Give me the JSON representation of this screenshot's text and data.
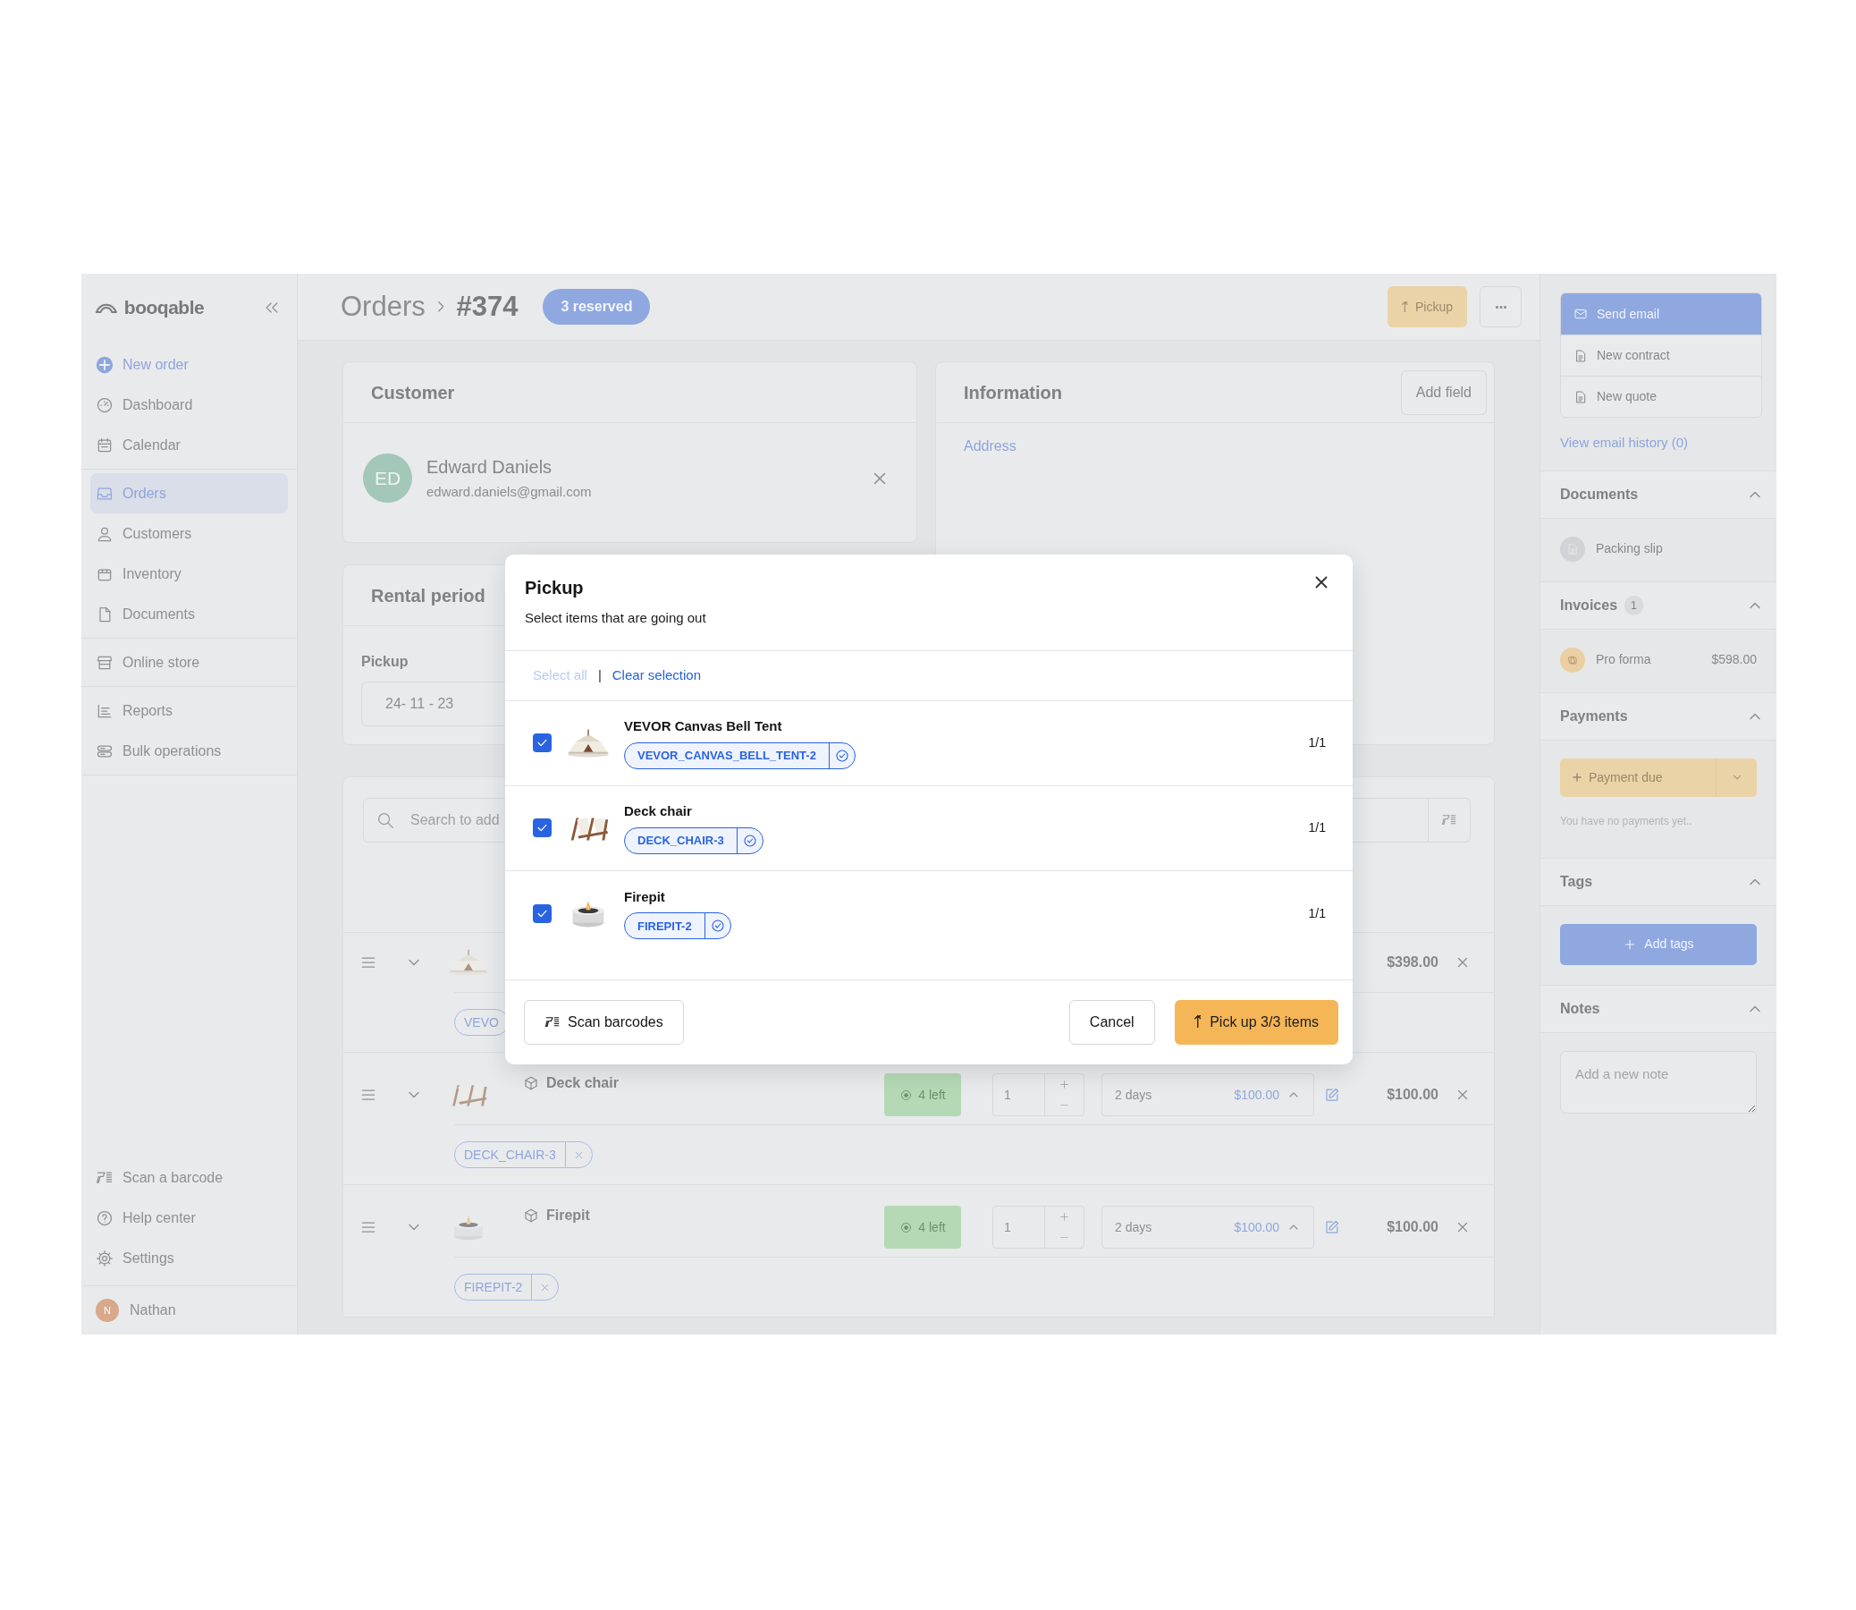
{
  "sidebar": {
    "brand": "booqable",
    "groups": [
      {
        "items": [
          {
            "label": "New order",
            "kind": "action",
            "selected": false
          },
          {
            "label": "Dashboard",
            "kind": "link",
            "selected": false
          },
          {
            "label": "Calendar",
            "kind": "link",
            "selected": false
          }
        ]
      },
      {
        "items": [
          {
            "label": "Orders",
            "kind": "link",
            "selected": true
          },
          {
            "label": "Customers",
            "kind": "link",
            "selected": false
          },
          {
            "label": "Inventory",
            "kind": "link",
            "selected": false
          },
          {
            "label": "Documents",
            "kind": "link",
            "selected": false
          }
        ]
      },
      {
        "items": [
          {
            "label": "Online store",
            "kind": "link",
            "selected": false
          }
        ]
      },
      {
        "items": [
          {
            "label": "Reports",
            "kind": "link",
            "selected": false
          },
          {
            "label": "Bulk operations",
            "kind": "link",
            "selected": false
          }
        ]
      }
    ],
    "bottom_items": [
      {
        "label": "Scan a barcode",
        "selected": false
      },
      {
        "label": "Help center",
        "selected": false
      },
      {
        "label": "Settings",
        "selected": false
      }
    ],
    "user": {
      "initial": "N",
      "name": "Nathan"
    }
  },
  "header": {
    "breadcrumb": "Orders",
    "order_number": "#374",
    "status": "3 reserved",
    "pickup_button": "Pickup"
  },
  "customer": {
    "title": "Customer",
    "initials": "ED",
    "name": "Edward Daniels",
    "email": "edward.daniels@gmail.com"
  },
  "information": {
    "title": "Information",
    "add_button": "Add field",
    "address_link": "Address"
  },
  "rental_period": {
    "title": "Rental period",
    "pickup_label": "Pickup",
    "pickup_date": "24- 11 - 23"
  },
  "order_lines": {
    "search_placeholder": "Search to add",
    "lines": [
      {
        "total": "$398.00",
        "tag": "VEVO",
        "tag_remove": false
      },
      {
        "name": "Deck chair",
        "stock": "4 left",
        "quantity": "1",
        "duration": "2 days",
        "rate": "$100.00",
        "total": "$100.00",
        "tag": "DECK_CHAIR-3",
        "tag_remove": true
      },
      {
        "name": "Firepit",
        "stock": "4 left",
        "quantity": "1",
        "duration": "2 days",
        "rate": "$100.00",
        "total": "$100.00",
        "tag": "FIREPIT-2",
        "tag_remove": true
      }
    ]
  },
  "right_panel": {
    "email_actions": [
      {
        "label": "Send email",
        "selected": true
      },
      {
        "label": "New contract",
        "selected": false
      },
      {
        "label": "New quote",
        "selected": false
      }
    ],
    "history_link": "View email history (0)",
    "sections": [
      {
        "kind": "documents",
        "title": "Documents",
        "expanded": true,
        "items": [
          {
            "label": "Packing slip"
          }
        ]
      },
      {
        "kind": "invoices",
        "title": "Invoices",
        "count": "1",
        "expanded": true,
        "items": [
          {
            "label": "Pro forma",
            "amount": "$598.00"
          }
        ]
      },
      {
        "kind": "payments",
        "title": "Payments",
        "expanded": true,
        "button": "Payment due",
        "empty_text": "You have no payments yet.."
      },
      {
        "kind": "tags",
        "title": "Tags",
        "expanded": true,
        "button": "Add tags"
      },
      {
        "kind": "notes",
        "title": "Notes",
        "expanded": true,
        "placeholder": "Add a new note"
      }
    ]
  },
  "modal": {
    "title": "Pickup",
    "subtitle": "Select items that are going out",
    "select_all": {
      "label": "Select all",
      "disabled": true
    },
    "separator": "|",
    "clear_selection": "Clear selection",
    "items": [
      {
        "name": "VEVOR Canvas Bell Tent",
        "tag": "VEVOR_CANVAS_BELL_TENT-2",
        "checked": true,
        "count": "1/1"
      },
      {
        "name": "Deck chair",
        "tag": "DECK_CHAIR-3",
        "checked": true,
        "count": "1/1"
      },
      {
        "name": "Firepit",
        "tag": "FIREPIT-2",
        "checked": true,
        "count": "1/1"
      }
    ],
    "scan_button": "Scan barcodes",
    "cancel_button": "Cancel",
    "confirm_button": "Pick up 3/3 items"
  }
}
